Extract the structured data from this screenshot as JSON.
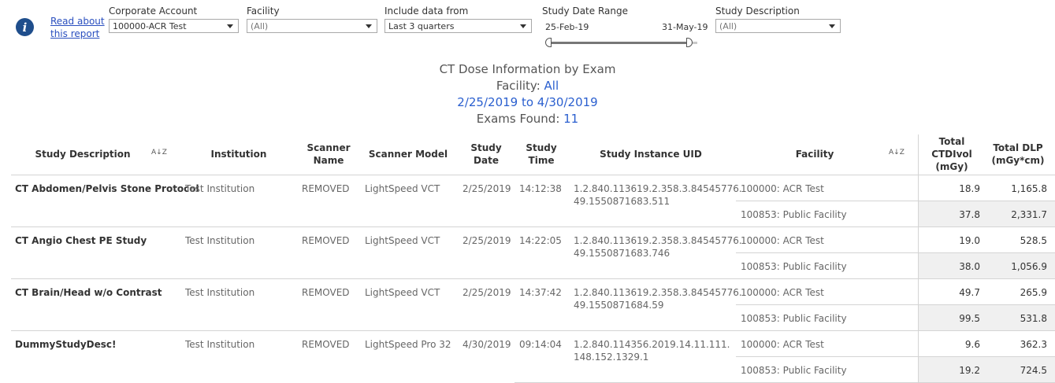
{
  "filters": {
    "read_about": "Read about this report",
    "corporate_account": {
      "label": "Corporate Account",
      "value": "100000-ACR Test"
    },
    "facility": {
      "label": "Facility",
      "value": "(All)"
    },
    "include_data_from": {
      "label": "Include data from",
      "value": "Last 3 quarters"
    },
    "study_date_range": {
      "label": "Study Date Range",
      "start": "25-Feb-19",
      "end": "31-May-19"
    },
    "study_description": {
      "label": "Study Description",
      "value": "(All)"
    }
  },
  "title": {
    "line1": "CT Dose Information by Exam",
    "facility_label": "Facility: ",
    "facility_value": "All",
    "date_range": "2/25/2019 to 4/30/2019",
    "exams_label": "Exams Found: ",
    "exams_value": "11"
  },
  "table": {
    "headers": {
      "study_description": "Study Description",
      "institution": "Institution",
      "scanner_name": "Scanner Name",
      "scanner_model": "Scanner Model",
      "study_date": "Study Date",
      "study_time": "Study Time",
      "study_uid": "Study Instance UID",
      "facility": "Facility",
      "ctdivol": "Total CTDIvol (mGy)",
      "dlp": "Total DLP (mGy*cm)"
    },
    "sort_glyph": "A↓Z",
    "rows": [
      {
        "desc": "CT Abdomen/Pelvis Stone Protocol",
        "institution": "Test Institution",
        "scanner": "REMOVED",
        "model": "LightSpeed VCT",
        "date": "2/25/2019",
        "time": "14:12:38",
        "uid1": "1.2.840.113619.2.358.3.84545776.",
        "uid2": "49.1550871683.511",
        "facilities": [
          {
            "name": "100000: ACR Test",
            "ctdi": "18.9",
            "dlp": "1,165.8"
          },
          {
            "name": "100853: Public Facility",
            "ctdi": "37.8",
            "dlp": "2,331.7"
          }
        ]
      },
      {
        "desc": "CT Angio Chest PE Study",
        "institution": "Test Institution",
        "scanner": "REMOVED",
        "model": "LightSpeed VCT",
        "date": "2/25/2019",
        "time": "14:22:05",
        "uid1": "1.2.840.113619.2.358.3.84545776.",
        "uid2": "49.1550871683.746",
        "facilities": [
          {
            "name": "100000: ACR Test",
            "ctdi": "19.0",
            "dlp": "528.5"
          },
          {
            "name": "100853: Public Facility",
            "ctdi": "38.0",
            "dlp": "1,056.9"
          }
        ]
      },
      {
        "desc": "CT Brain/Head w/o Contrast",
        "institution": "Test Institution",
        "scanner": "REMOVED",
        "model": "LightSpeed VCT",
        "date": "2/25/2019",
        "time": "14:37:42",
        "uid1": "1.2.840.113619.2.358.3.84545776.",
        "uid2": "49.1550871684.59",
        "facilities": [
          {
            "name": "100000: ACR Test",
            "ctdi": "49.7",
            "dlp": "265.9"
          },
          {
            "name": "100853: Public Facility",
            "ctdi": "99.5",
            "dlp": "531.8"
          }
        ]
      },
      {
        "desc": "DummyStudyDesc!",
        "institution": "Test Institution",
        "scanner": "REMOVED",
        "model": "LightSpeed Pro 32",
        "date": "4/30/2019",
        "time": "09:14:04",
        "uid1": "1.2.840.114356.2019.14.11.111.",
        "uid2": "148.152.1329.1",
        "facilities": [
          {
            "name": "100000: ACR Test",
            "ctdi": "9.6",
            "dlp": "362.3"
          },
          {
            "name": "100853: Public Facility",
            "ctdi": "19.2",
            "dlp": "724.5"
          }
        ]
      }
    ]
  }
}
